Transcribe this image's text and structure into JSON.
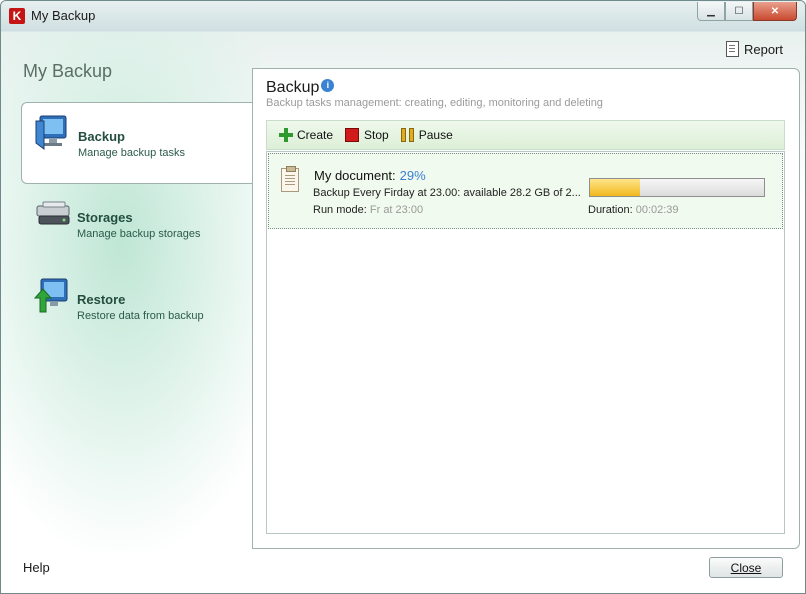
{
  "window": {
    "title": "My Backup"
  },
  "header": {
    "report_label": "Report"
  },
  "sidebar": {
    "heading": "My Backup",
    "items": [
      {
        "title": "Backup",
        "subtitle": "Manage backup tasks",
        "icon": "monitor-backup-icon",
        "active": true
      },
      {
        "title": "Storages",
        "subtitle": "Manage backup storages",
        "icon": "storage-drive-icon",
        "active": false
      },
      {
        "title": "Restore",
        "subtitle": "Restore data from backup",
        "icon": "restore-arrow-icon",
        "active": false
      }
    ]
  },
  "main": {
    "title": "Backup",
    "subtitle": "Backup tasks management: creating, editing, monitoring and deleting",
    "toolbar": {
      "create_label": "Create",
      "stop_label": "Stop",
      "pause_label": "Pause"
    },
    "tasks": [
      {
        "name": "My document:",
        "progress_text": "29%",
        "progress_fraction": 0.29,
        "detail": "Backup Every Firday at 23.00: available 28.2 GB of 2...",
        "run_mode_label": "Run mode:",
        "run_mode_value": "Fr at 23:00",
        "duration_label": "Duration:",
        "duration_value": "00:02:39"
      }
    ]
  },
  "footer": {
    "help_label": "Help",
    "close_label": "Close"
  },
  "colors": {
    "accent_green": "#234e3f",
    "progress": "#f2b81c",
    "link_blue": "#3a7fd5"
  }
}
